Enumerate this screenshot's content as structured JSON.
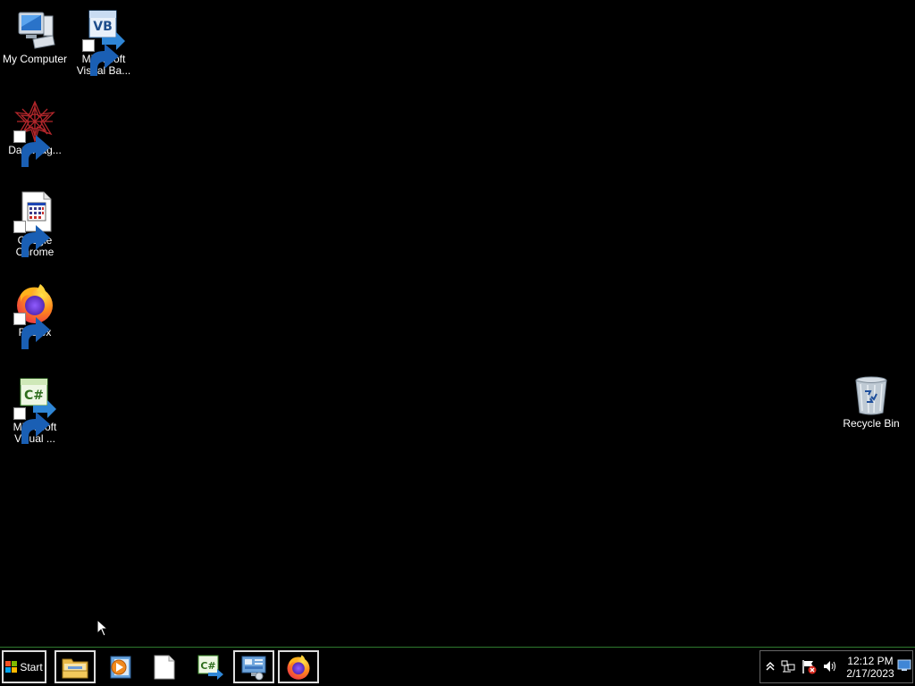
{
  "desktop": {
    "icons": [
      {
        "label": "My Computer",
        "icon": "computer-icon"
      },
      {
        "label": "Microsoft\nVisual Ba...",
        "icon": "visual-basic-icon"
      },
      {
        "label": "DataWag...",
        "icon": "datawag-icon"
      },
      {
        "label": "Google\nChrome",
        "icon": "chrome-document-icon"
      },
      {
        "label": "Firefox",
        "icon": "firefox-icon"
      },
      {
        "label": "Microsoft\nVisual ...",
        "icon": "visual-csharp-icon"
      },
      {
        "label": "Recycle Bin",
        "icon": "recycle-bin-icon"
      }
    ]
  },
  "taskbar": {
    "start_label": "Start",
    "buttons": [
      {
        "icon": "file-explorer-icon",
        "active": true
      },
      {
        "icon": "media-player-icon",
        "active": false
      },
      {
        "icon": "blank-document-icon",
        "active": false
      },
      {
        "icon": "visual-csharp-icon",
        "active": false
      },
      {
        "icon": "control-panel-icon",
        "active": true
      },
      {
        "icon": "firefox-icon",
        "active": true
      }
    ],
    "tray": {
      "icons": [
        "show-hidden-icons-chevron",
        "network-icon",
        "action-center-flag-icon",
        "volume-icon"
      ],
      "time": "12:12 PM",
      "date": "2/17/2023"
    }
  },
  "colors": {
    "background": "#000000",
    "taskbar_border": "#2e7a2e"
  }
}
